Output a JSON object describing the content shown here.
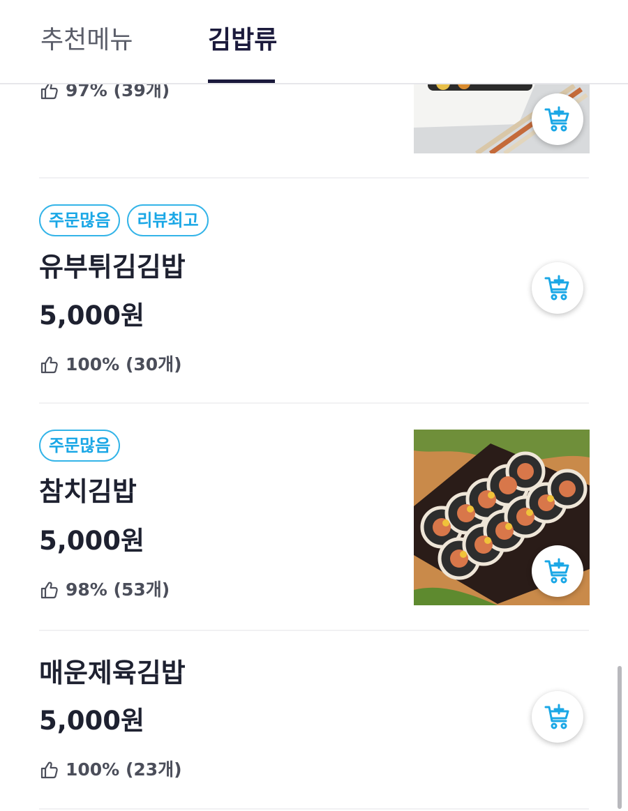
{
  "tabs": [
    {
      "label": "추천메뉴",
      "active": false
    },
    {
      "label": "김밥류",
      "active": true
    }
  ],
  "colors": {
    "accent": "#1aa7e6",
    "tab_active": "#1b1a3c",
    "text": "#1e2130",
    "muted": "#4b4e5a"
  },
  "items": [
    {
      "name": "",
      "price": "",
      "rating": "97% (39개)",
      "badges": [],
      "has_photo": true,
      "cart_icon": "cart-plus-icon"
    },
    {
      "name": "유부튀김김밥",
      "price": "5,000원",
      "rating": "100% (30개)",
      "badges": [
        "주문많음",
        "리뷰최고"
      ],
      "has_photo": false,
      "cart_icon": "cart-plus-icon"
    },
    {
      "name": "참치김밥",
      "price": "5,000원",
      "rating": "98% (53개)",
      "badges": [
        "주문많음"
      ],
      "has_photo": true,
      "cart_icon": "cart-plus-icon"
    },
    {
      "name": "매운제육김밥",
      "price": "5,000원",
      "rating": "100% (23개)",
      "badges": [],
      "has_photo": false,
      "cart_icon": "cart-plus-icon"
    }
  ]
}
